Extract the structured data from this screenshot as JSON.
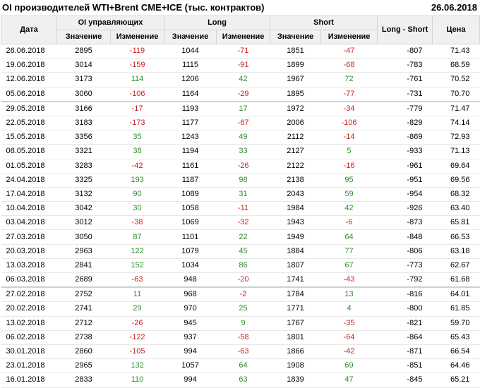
{
  "header": {
    "title": "OI производителей WTI+Brent CME+ICE (тыс. контрактов)",
    "date": "26.06.2018"
  },
  "columns": {
    "date": "Дата",
    "oi_group": "OI управляющих",
    "long_group": "Long",
    "short_group": "Short",
    "long_short": "Long - Short",
    "price": "Цена",
    "value": "Значение",
    "change": "Изменение"
  },
  "rows": [
    {
      "date": "26.06.2018",
      "oi": "2895",
      "oi_chg": "-119",
      "long": "1044",
      "long_chg": "-71",
      "short": "1851",
      "short_chg": "-47",
      "ls": "-807",
      "price": "71.43"
    },
    {
      "date": "19.06.2018",
      "oi": "3014",
      "oi_chg": "-159",
      "long": "1115",
      "long_chg": "-91",
      "short": "1899",
      "short_chg": "-68",
      "ls": "-783",
      "price": "68.59"
    },
    {
      "date": "12.06.2018",
      "oi": "3173",
      "oi_chg": "114",
      "long": "1206",
      "long_chg": "42",
      "short": "1967",
      "short_chg": "72",
      "ls": "-761",
      "price": "70.52"
    },
    {
      "date": "05.06.2018",
      "oi": "3060",
      "oi_chg": "-106",
      "long": "1164",
      "long_chg": "-29",
      "short": "1895",
      "short_chg": "-77",
      "ls": "-731",
      "price": "70.70"
    },
    {
      "date": "29.05.2018",
      "oi": "3166",
      "oi_chg": "-17",
      "long": "1193",
      "long_chg": "17",
      "short": "1972",
      "short_chg": "-34",
      "ls": "-779",
      "price": "71.47"
    },
    {
      "date": "22.05.2018",
      "oi": "3183",
      "oi_chg": "-173",
      "long": "1177",
      "long_chg": "-67",
      "short": "2006",
      "short_chg": "-106",
      "ls": "-829",
      "price": "74.14"
    },
    {
      "date": "15.05.2018",
      "oi": "3356",
      "oi_chg": "35",
      "long": "1243",
      "long_chg": "49",
      "short": "2112",
      "short_chg": "-14",
      "ls": "-869",
      "price": "72.93"
    },
    {
      "date": "08.05.2018",
      "oi": "3321",
      "oi_chg": "38",
      "long": "1194",
      "long_chg": "33",
      "short": "2127",
      "short_chg": "5",
      "ls": "-933",
      "price": "71.13"
    },
    {
      "date": "01.05.2018",
      "oi": "3283",
      "oi_chg": "-42",
      "long": "1161",
      "long_chg": "-26",
      "short": "2122",
      "short_chg": "-16",
      "ls": "-961",
      "price": "69.64"
    },
    {
      "date": "24.04.2018",
      "oi": "3325",
      "oi_chg": "193",
      "long": "1187",
      "long_chg": "98",
      "short": "2138",
      "short_chg": "95",
      "ls": "-951",
      "price": "69.56"
    },
    {
      "date": "17.04.2018",
      "oi": "3132",
      "oi_chg": "90",
      "long": "1089",
      "long_chg": "31",
      "short": "2043",
      "short_chg": "59",
      "ls": "-954",
      "price": "68.32"
    },
    {
      "date": "10.04.2018",
      "oi": "3042",
      "oi_chg": "30",
      "long": "1058",
      "long_chg": "-11",
      "short": "1984",
      "short_chg": "42",
      "ls": "-926",
      "price": "63.40"
    },
    {
      "date": "03.04.2018",
      "oi": "3012",
      "oi_chg": "-38",
      "long": "1069",
      "long_chg": "-32",
      "short": "1943",
      "short_chg": "-6",
      "ls": "-873",
      "price": "65.81"
    },
    {
      "date": "27.03.2018",
      "oi": "3050",
      "oi_chg": "87",
      "long": "1101",
      "long_chg": "22",
      "short": "1949",
      "short_chg": "64",
      "ls": "-848",
      "price": "66.53"
    },
    {
      "date": "20.03.2018",
      "oi": "2963",
      "oi_chg": "122",
      "long": "1079",
      "long_chg": "45",
      "short": "1884",
      "short_chg": "77",
      "ls": "-806",
      "price": "63.18"
    },
    {
      "date": "13.03.2018",
      "oi": "2841",
      "oi_chg": "152",
      "long": "1034",
      "long_chg": "86",
      "short": "1807",
      "short_chg": "67",
      "ls": "-773",
      "price": "62.67"
    },
    {
      "date": "06.03.2018",
      "oi": "2689",
      "oi_chg": "-63",
      "long": "948",
      "long_chg": "-20",
      "short": "1741",
      "short_chg": "-43",
      "ls": "-792",
      "price": "61.68"
    },
    {
      "date": "27.02.2018",
      "oi": "2752",
      "oi_chg": "11",
      "long": "968",
      "long_chg": "-2",
      "short": "1784",
      "short_chg": "13",
      "ls": "-816",
      "price": "64.01"
    },
    {
      "date": "20.02.2018",
      "oi": "2741",
      "oi_chg": "29",
      "long": "970",
      "long_chg": "25",
      "short": "1771",
      "short_chg": "4",
      "ls": "-800",
      "price": "61.85"
    },
    {
      "date": "13.02.2018",
      "oi": "2712",
      "oi_chg": "-26",
      "long": "945",
      "long_chg": "9",
      "short": "1767",
      "short_chg": "-35",
      "ls": "-821",
      "price": "59.70"
    },
    {
      "date": "06.02.2018",
      "oi": "2738",
      "oi_chg": "-122",
      "long": "937",
      "long_chg": "-58",
      "short": "1801",
      "short_chg": "-64",
      "ls": "-864",
      "price": "65.43"
    },
    {
      "date": "30.01.2018",
      "oi": "2860",
      "oi_chg": "-105",
      "long": "994",
      "long_chg": "-63",
      "short": "1866",
      "short_chg": "-42",
      "ls": "-871",
      "price": "66.54"
    },
    {
      "date": "23.01.2018",
      "oi": "2965",
      "oi_chg": "132",
      "long": "1057",
      "long_chg": "64",
      "short": "1908",
      "short_chg": "69",
      "ls": "-851",
      "price": "64.46"
    },
    {
      "date": "16.01.2018",
      "oi": "2833",
      "oi_chg": "110",
      "long": "994",
      "long_chg": "63",
      "short": "1839",
      "short_chg": "47",
      "ls": "-845",
      "price": "65.21"
    }
  ],
  "colors": {
    "positive": "#2e8b2e",
    "negative": "#cc1f1f",
    "header_bg": "#f0f0f0"
  }
}
